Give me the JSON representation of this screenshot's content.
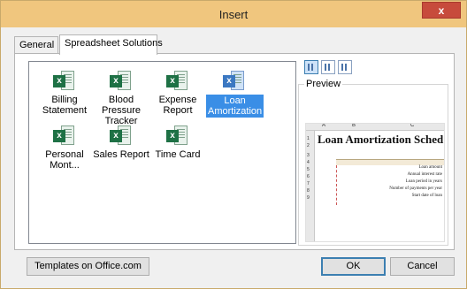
{
  "window": {
    "title": "Insert",
    "close_label": "x"
  },
  "tabs": [
    {
      "label": "General",
      "active": false
    },
    {
      "label": "Spreadsheet Solutions",
      "active": true
    }
  ],
  "templates": [
    {
      "label": "Billing Statement",
      "icon": "excel-template-icon",
      "selected": false
    },
    {
      "label": "Blood Pressure Tracker",
      "icon": "excel-template-icon",
      "selected": false
    },
    {
      "label": "Expense Report",
      "icon": "excel-template-icon",
      "selected": false
    },
    {
      "label": "Loan Amortization",
      "icon": "excel-template-icon",
      "selected": true
    },
    {
      "label": "Personal Mont...",
      "icon": "excel-template-icon",
      "selected": false
    },
    {
      "label": "Sales Report",
      "icon": "excel-template-icon",
      "selected": false
    },
    {
      "label": "Time Card",
      "icon": "excel-template-icon",
      "selected": false
    }
  ],
  "view_buttons": [
    "large-icons-view-icon",
    "list-view-icon",
    "details-view-icon"
  ],
  "preview": {
    "label": "Preview",
    "columns": [
      "A",
      "B",
      "C"
    ],
    "rows": [
      "1",
      "2",
      "3",
      "4",
      "5",
      "6",
      "7",
      "8",
      "9"
    ],
    "title": "Loan Amortization Sched",
    "fields": [
      "Loan amount",
      "Annual interest rate",
      "Loan period in years",
      "Number of payments per year",
      "Start date of loan"
    ]
  },
  "buttons": {
    "templates": "Templates on Office.com",
    "ok": "OK",
    "cancel": "Cancel"
  },
  "colors": {
    "titlebar": "#f0c67e",
    "selection": "#3a8ee6",
    "close": "#c74b3c"
  }
}
